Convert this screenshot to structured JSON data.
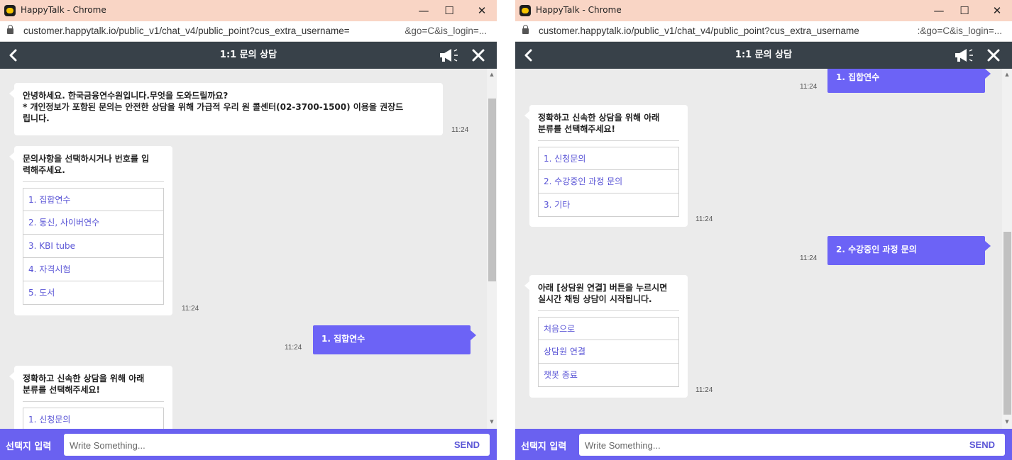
{
  "window": {
    "title": "HappyTalk - Chrome",
    "min_glyph": "—",
    "max_glyph": "☐",
    "close_glyph": "✕"
  },
  "url": {
    "left_visible": "customer.happytalk.io/public_v1/chat_v4/public_point?cus_extra_username=",
    "left_tail": "&go=C&is_login=...",
    "right_visible": "customer.happytalk.io/public_v1/chat_v4/public_point?cus_extra_username",
    "right_tail": ":&go=C&is_login=..."
  },
  "header": {
    "title": "1:1 문의 상담"
  },
  "composer": {
    "select_label": "선택지 입력",
    "placeholder": "Write Something...",
    "send_label": "SEND"
  },
  "left_chat": {
    "greeting": {
      "line1": "안녕하세요. 한국금융연수원입니다.무엇을 도와드릴까요?",
      "line2": "* 개인정보가 포함된 문의는 안전한 상담을 위해 가급적 우리 원 콜센터(02-3700-1500) 이용을 권장드",
      "line3": "립니다.",
      "time": "11:24"
    },
    "menu": {
      "line1": "문의사항을 선택하시거나 번호를 입",
      "line2": "력해주세요.",
      "options": [
        "1. 집합연수",
        "2. 통신, 사이버연수",
        "3. KBI tube",
        "4. 자격시험",
        "5. 도서"
      ],
      "time": "11:24"
    },
    "user_reply": {
      "text": "1. 집합연수",
      "time": "11:24"
    },
    "category": {
      "line1": "정확하고 신속한 상담을 위해 아래",
      "line2": "분류를 선택해주세요!",
      "options": [
        "1. 신청문의"
      ]
    }
  },
  "right_chat": {
    "user_reply_top": {
      "text": "1. 집합연수",
      "time": "11:24"
    },
    "category": {
      "line1": "정확하고 신속한 상담을 위해 아래",
      "line2": "분류를 선택해주세요!",
      "options": [
        "1. 신청문의",
        "2. 수강중인 과정 문의",
        "3. 기타"
      ],
      "time": "11:24"
    },
    "user_reply": {
      "text": "2. 수강중인 과정 문의",
      "time": "11:24"
    },
    "agent_connect": {
      "line1": "아래 [상담원 연결] 버튼을 누르시면",
      "line2": "실시간 채팅 상담이 시작됩니다.",
      "options": [
        "처음으로",
        "상담원 연결",
        "챗봇 종료"
      ],
      "time": "11:24"
    }
  }
}
